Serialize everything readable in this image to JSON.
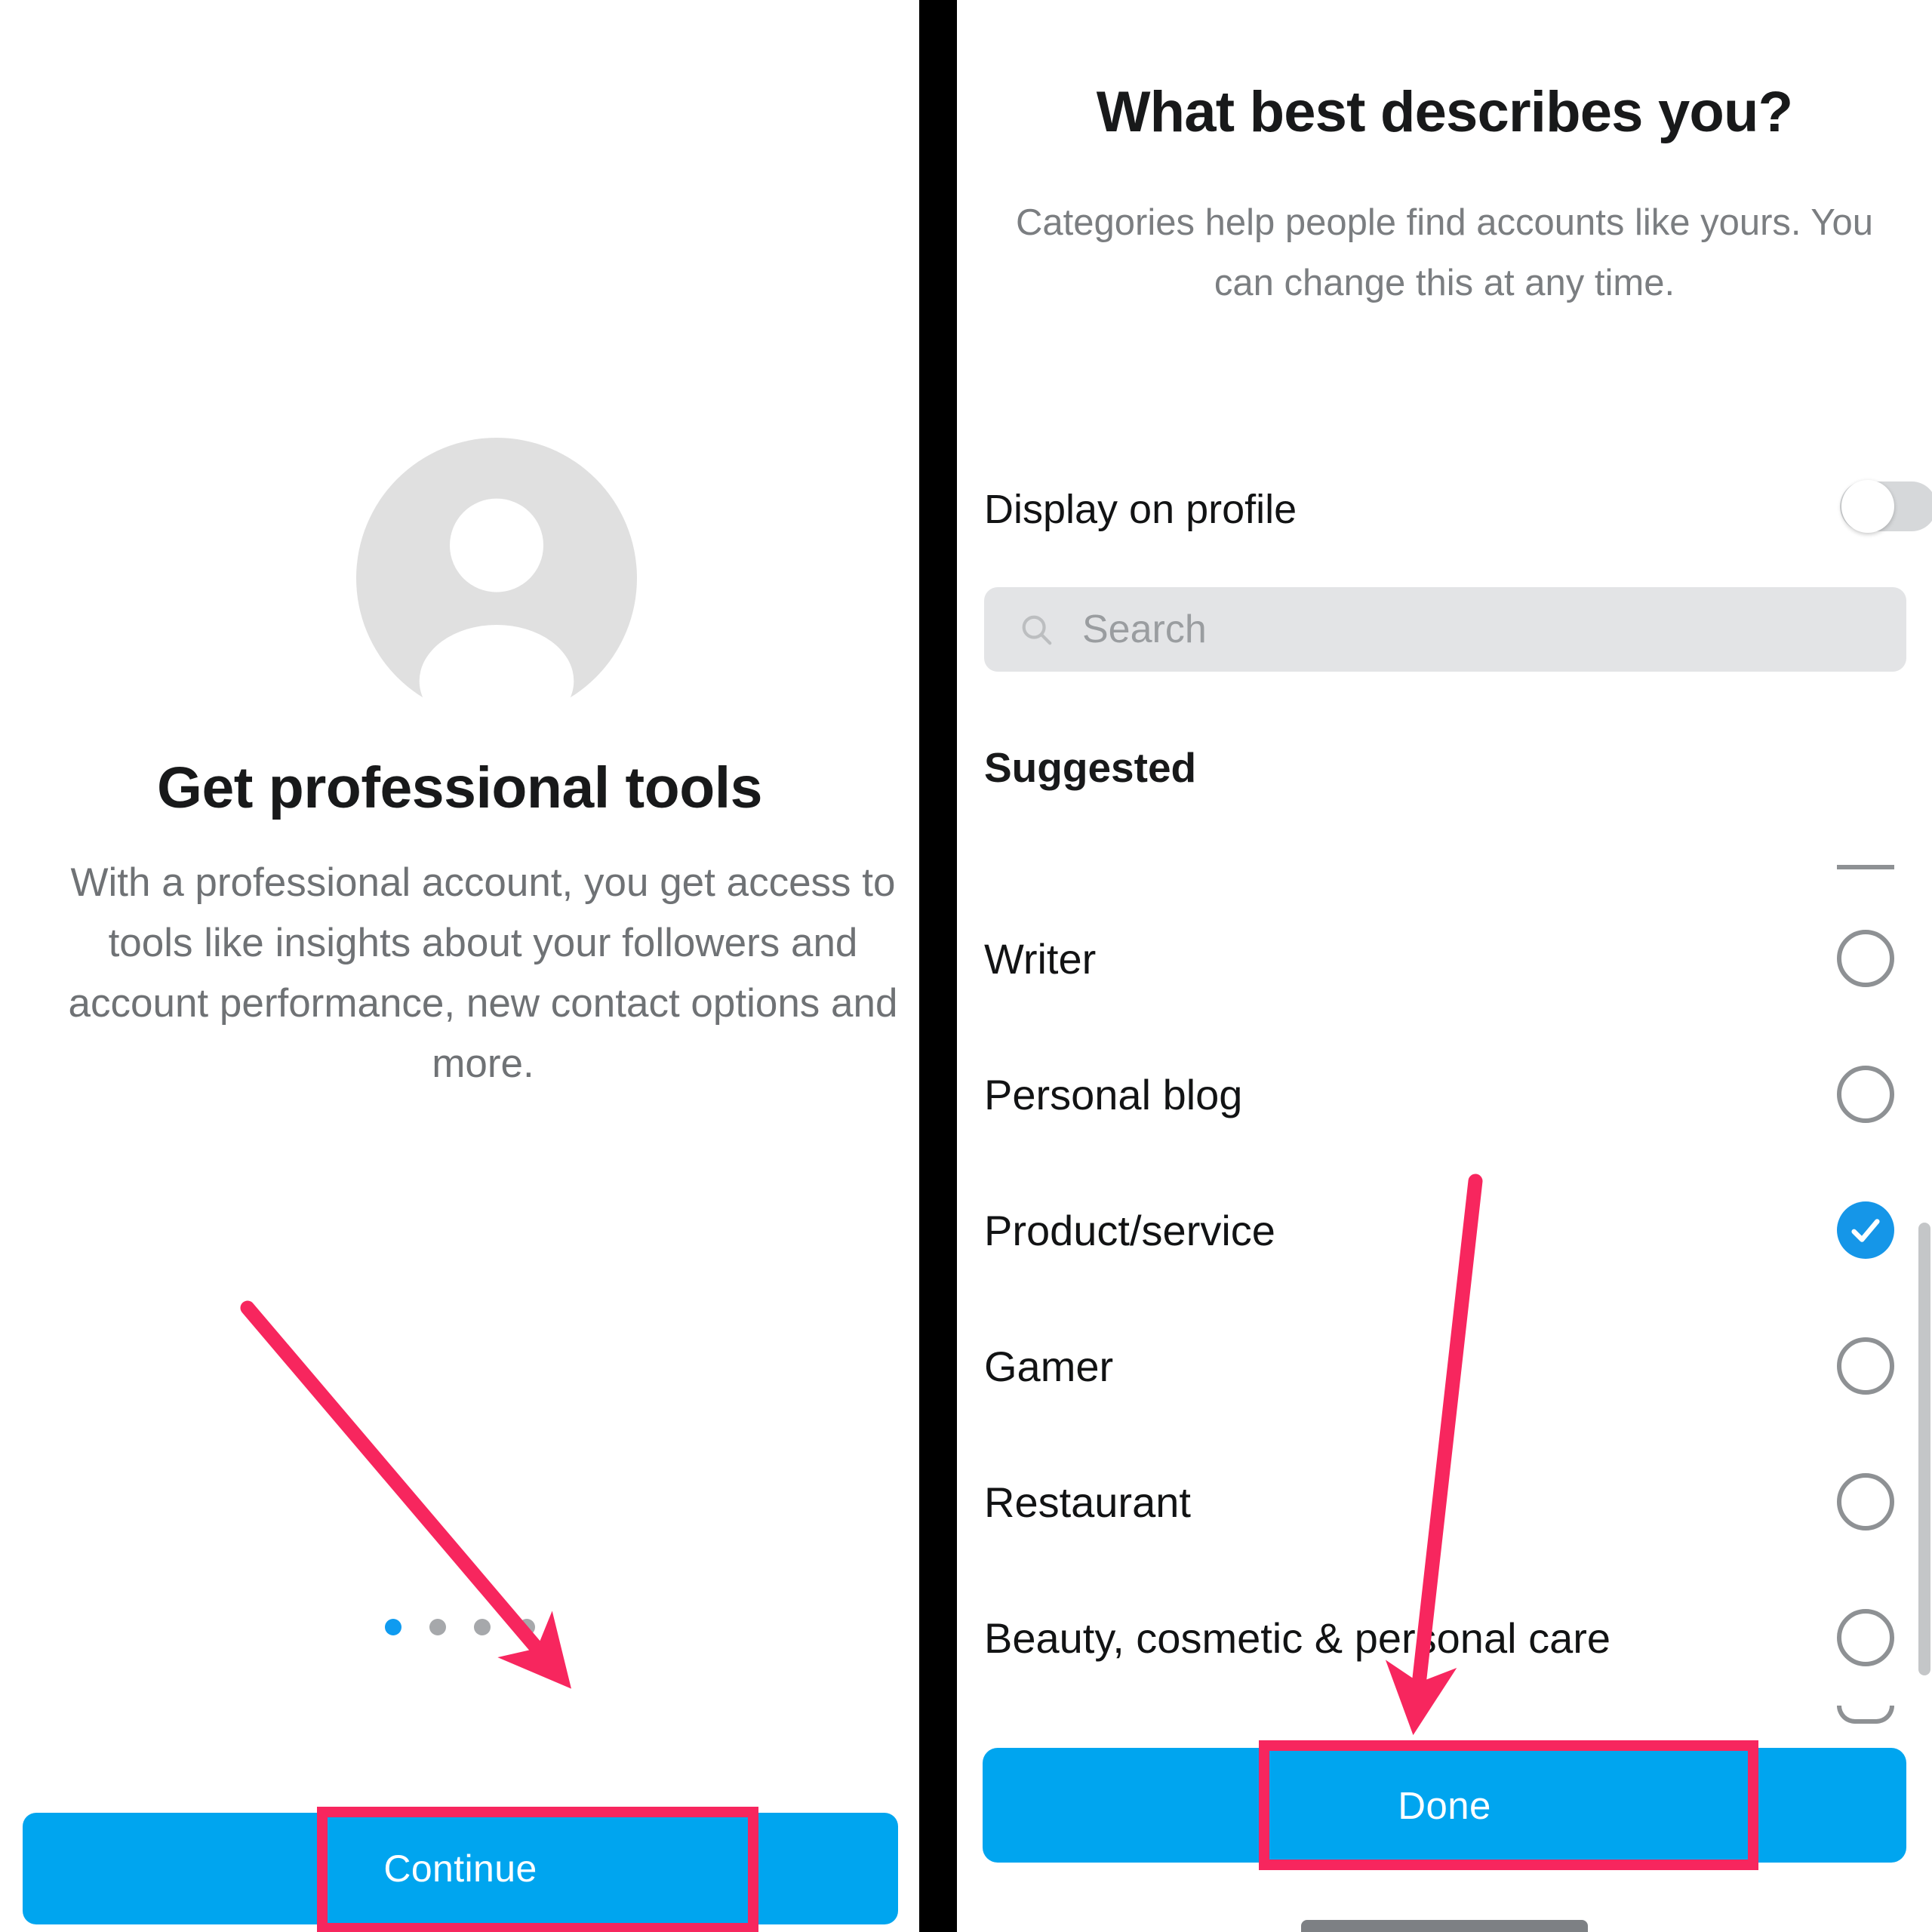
{
  "accent_colors": {
    "brand_blue": "#00a5ef",
    "selected_blue": "#1596e8",
    "annotation_pink": "#f7265e",
    "divider_black": "#000000",
    "muted_text": "#7b7e81",
    "placeholder_gray": "#9a9da0",
    "field_background": "#e3e4e6",
    "toggle_track_off": "#d6d8da",
    "avatar_gray": "#e0e0e0",
    "dot_inactive": "#a6a8ab",
    "dot_active": "#0f9bf0",
    "scrollbar_gray": "#c4c6c8"
  },
  "left_screen": {
    "avatar_icon": "person-placeholder-icon",
    "title": "Get professional tools",
    "body": "With a professional account, you get access to tools like insights about your followers and account performance, new contact options and more.",
    "page_dots": {
      "count": 4,
      "active_index": 0
    },
    "primary_button": {
      "label": "Continue"
    },
    "annotation": {
      "shape": "arrow",
      "points_to": "Continue",
      "highlight": "rectangle-around-continue"
    }
  },
  "right_screen": {
    "title": "What best describes you?",
    "subtitle": "Categories help people find accounts like yours. You can change this at any time.",
    "display_on_profile": {
      "label": "Display on profile",
      "toggle_state": "off"
    },
    "search": {
      "icon": "search-icon",
      "placeholder": "Search",
      "value": ""
    },
    "section_label": "Suggested",
    "categories": [
      {
        "label": "",
        "state": "clipped-top",
        "selected": false
      },
      {
        "label": "Writer",
        "state": "full",
        "selected": false
      },
      {
        "label": "Personal blog",
        "state": "full",
        "selected": false
      },
      {
        "label": "Product/service",
        "state": "full",
        "selected": true
      },
      {
        "label": "Gamer",
        "state": "full",
        "selected": false
      },
      {
        "label": "Restaurant",
        "state": "full",
        "selected": false
      },
      {
        "label": "Beauty, cosmetic & personal care",
        "state": "full",
        "selected": false
      },
      {
        "label": "",
        "state": "clipped-bottom",
        "selected": false
      }
    ],
    "selected_category": "Product/service",
    "primary_button": {
      "label": "Done"
    },
    "annotation": {
      "shape": "arrow",
      "points_to": "Done",
      "highlight": "rectangle-around-done"
    },
    "scrollbar_visible": true,
    "system_nav_pill": true
  }
}
